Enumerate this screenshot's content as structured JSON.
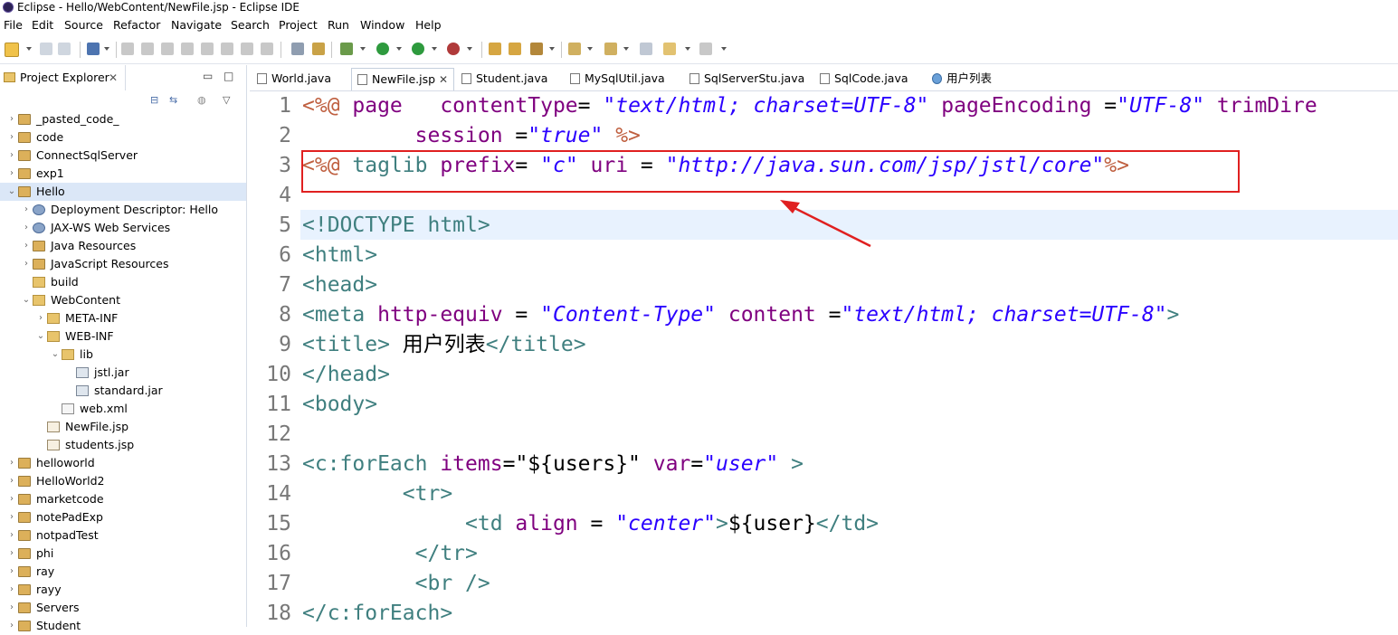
{
  "window": {
    "title": "Eclipse - Hello/WebContent/NewFile.jsp - Eclipse IDE"
  },
  "menu": [
    "File",
    "Edit",
    "Source",
    "Refactor",
    "Navigate",
    "Search",
    "Project",
    "Run",
    "Window",
    "Help"
  ],
  "explorer": {
    "title": "Project Explorer",
    "close": "✕",
    "tree": [
      {
        "label": "_pasted_code_",
        "icon": "project-icon"
      },
      {
        "label": "code",
        "icon": "project-icon"
      },
      {
        "label": "ConnectSqlServer",
        "icon": "project-icon"
      },
      {
        "label": "exp1",
        "icon": "project-icon"
      },
      {
        "label": "Hello",
        "icon": "project-icon"
      },
      {
        "label": "Deployment Descriptor: Hello",
        "icon": "deployment-icon"
      },
      {
        "label": "JAX-WS Web Services",
        "icon": "webservice-icon"
      },
      {
        "label": "Java Resources",
        "icon": "java-resources-icon"
      },
      {
        "label": "JavaScript Resources",
        "icon": "js-resources-icon"
      },
      {
        "label": "build",
        "icon": "folder-icon"
      },
      {
        "label": "WebContent",
        "icon": "folder-icon"
      },
      {
        "label": "META-INF",
        "icon": "folder-icon"
      },
      {
        "label": "WEB-INF",
        "icon": "folder-icon"
      },
      {
        "label": "lib",
        "icon": "folder-icon"
      },
      {
        "label": "jstl.jar",
        "icon": "jar-icon"
      },
      {
        "label": "standard.jar",
        "icon": "jar-icon"
      },
      {
        "label": "web.xml",
        "icon": "xml-icon"
      },
      {
        "label": "NewFile.jsp",
        "icon": "jsp-icon"
      },
      {
        "label": "students.jsp",
        "icon": "jsp-icon"
      },
      {
        "label": "helloworld",
        "icon": "project-icon"
      },
      {
        "label": "HelloWorld2",
        "icon": "project-icon"
      },
      {
        "label": "marketcode",
        "icon": "project-icon"
      },
      {
        "label": "notePadExp",
        "icon": "project-icon"
      },
      {
        "label": "notpadTest",
        "icon": "project-icon"
      },
      {
        "label": "phi",
        "icon": "project-icon"
      },
      {
        "label": "ray",
        "icon": "project-icon"
      },
      {
        "label": "rayy",
        "icon": "project-icon"
      },
      {
        "label": "Servers",
        "icon": "project-icon"
      },
      {
        "label": "Student",
        "icon": "project-icon"
      }
    ]
  },
  "tabs": [
    {
      "label": "World.java"
    },
    {
      "label": "NewFile.jsp",
      "close": "✕"
    },
    {
      "label": "Student.java"
    },
    {
      "label": "MySqlUtil.java"
    },
    {
      "label": "SqlServerStu.java"
    },
    {
      "label": "SqlCode.java"
    },
    {
      "label": "用户列表"
    }
  ],
  "editor": {
    "line_numbers": [
      "1",
      "2",
      "3",
      "4",
      "5",
      "6",
      "7",
      "8",
      "9",
      "10",
      "11",
      "12",
      "13",
      "14",
      "15",
      "16",
      "17",
      "18"
    ],
    "lines": {
      "l1": {
        "a": "<%@",
        "b": " page",
        "c": "   contentType",
        "d": "= ",
        "e": "\"text/html; charset=UTF-8\"",
        "f": " pageEncoding",
        "g": " =",
        "h": "\"UTF-8\"",
        "i": " trimDire"
      },
      "l2": {
        "a": "         session",
        "b": " =",
        "c": "\"true\"",
        "d": " %>"
      },
      "l3": {
        "a": "<%@",
        "b": " taglib",
        "c": " prefix",
        "d": "= ",
        "e": "\"c\"",
        "f": " uri",
        "g": " = ",
        "h": "\"http://java.sun.com/jsp/jstl/core\"",
        "i": "%>"
      },
      "l5": {
        "a": "<!DOCTYPE html>"
      },
      "l6": {
        "a": "<html>"
      },
      "l7": {
        "a": "<head>"
      },
      "l8": {
        "a": "<meta",
        "b": " http-equiv",
        "c": " = ",
        "d": "\"Content-Type\"",
        "e": " content",
        "f": " =",
        "g": "\"text/html; charset=UTF-8\"",
        "h": ">"
      },
      "l9": {
        "a": "<title>",
        "b": " 用户列表",
        "c": "</title>"
      },
      "l10": {
        "a": "</head>"
      },
      "l11": {
        "a": "<body>"
      },
      "l13": {
        "a": "<c:forEach",
        "b": " items",
        "c": "=",
        "d": "\"${users}\"",
        "e": " var",
        "f": "=",
        "g": "\"user\"",
        "h": " >"
      },
      "l14": {
        "a": "        <tr>"
      },
      "l15": {
        "a": "             <td",
        "b": " align",
        "c": " = ",
        "d": "\"center\"",
        "e": ">",
        "f": "${user}",
        "g": "</td>"
      },
      "l16": {
        "a": "         </tr>"
      },
      "l17": {
        "a": "         <br />"
      },
      "l18": {
        "a": "</c:forEach>"
      }
    }
  },
  "colors": {
    "highlight": "#e02020",
    "directive": "#bf5f3f",
    "tag": "#3f7f7f",
    "attribute": "#7f007f",
    "string": "#2a00ff"
  }
}
